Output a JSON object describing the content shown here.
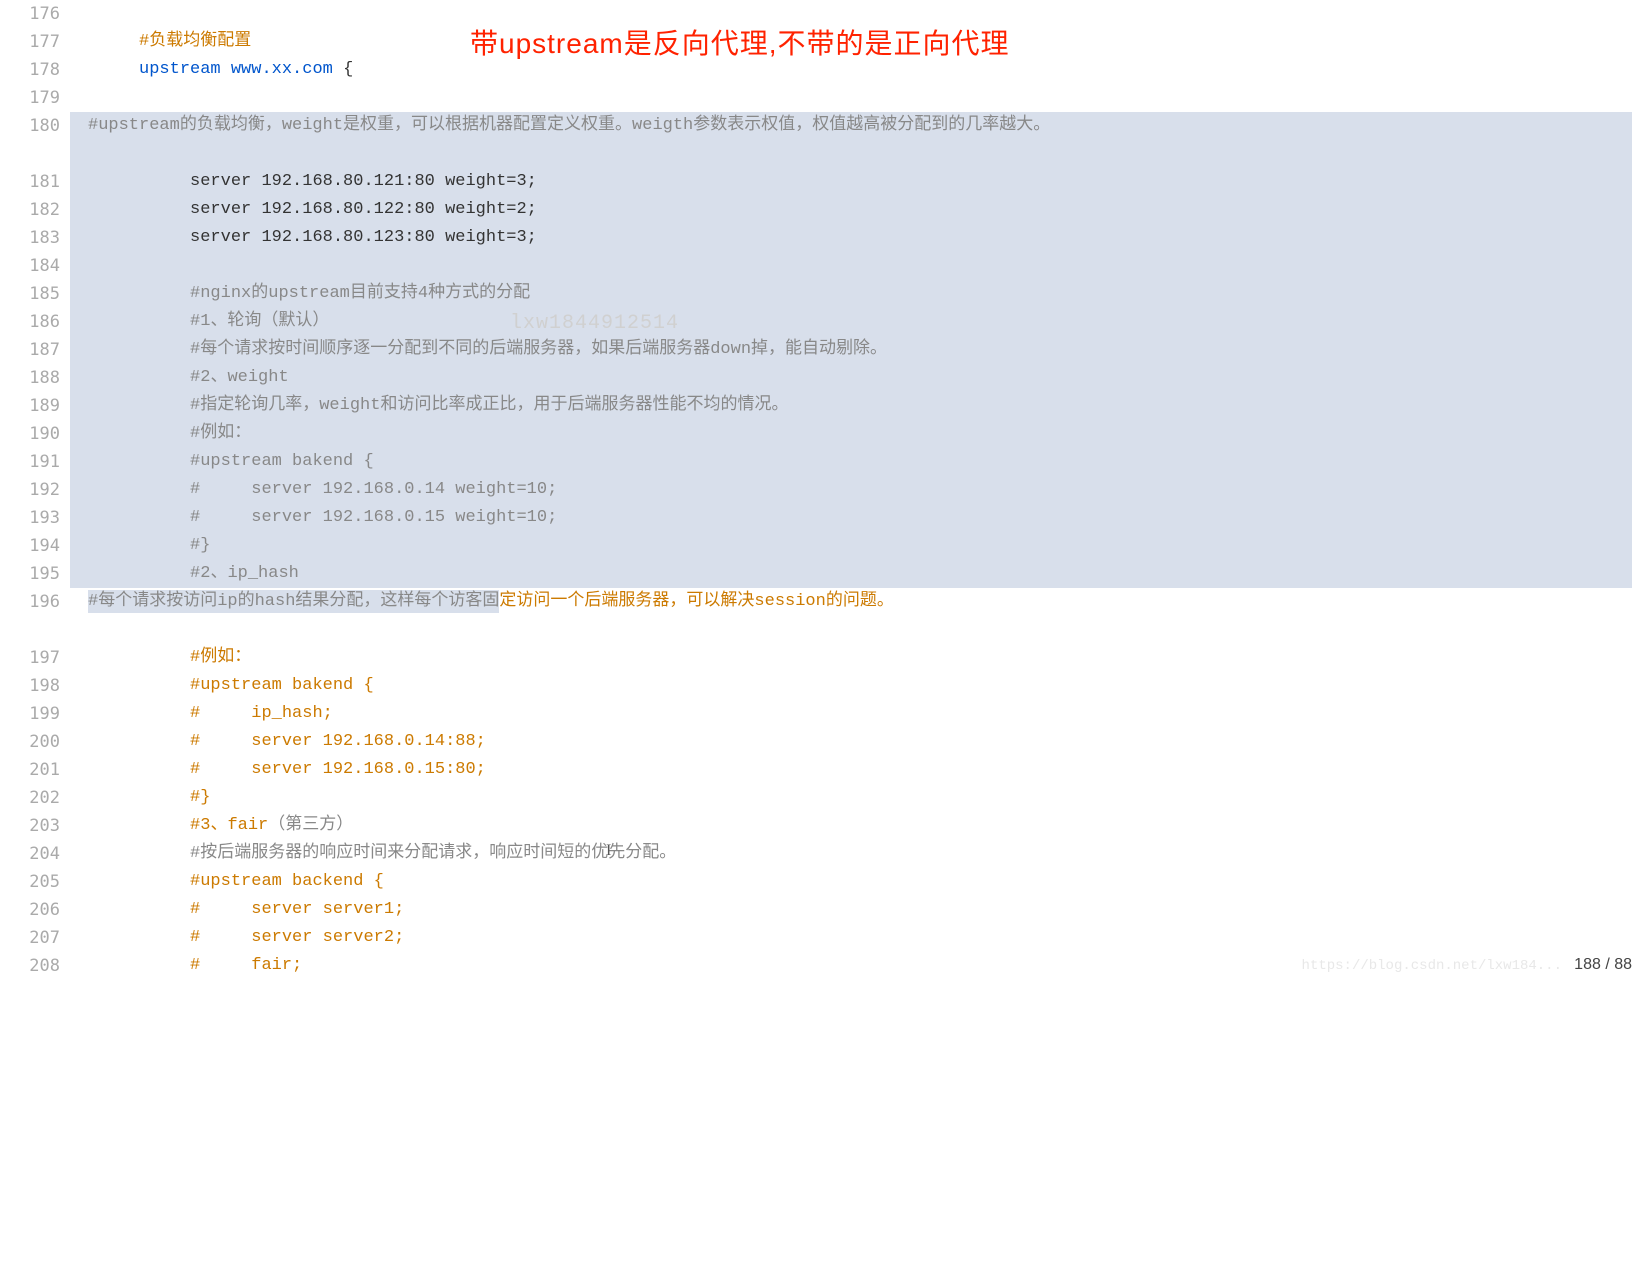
{
  "annotation": "带upstream是反向代理,不带的是正向代理",
  "watermark_center": "lxw1844912514",
  "watermark_bottom": "https://blog.csdn.net/lxw184...",
  "page_counter": "188 / 88",
  "lines": [
    {
      "num": "176",
      "indent": "",
      "highlight": false,
      "wrap": false,
      "segs": []
    },
    {
      "num": "177",
      "indent": "     ",
      "highlight": false,
      "wrap": false,
      "segs": [
        {
          "cls": "comment-orange",
          "t": "#负载均衡配置"
        }
      ]
    },
    {
      "num": "178",
      "indent": "     ",
      "highlight": false,
      "wrap": false,
      "segs": [
        {
          "cls": "kw",
          "t": "upstream"
        },
        {
          "cls": "txt",
          "t": " "
        },
        {
          "cls": "str",
          "t": "www.xx.com"
        },
        {
          "cls": "txt",
          "t": " {"
        }
      ]
    },
    {
      "num": "179",
      "indent": "",
      "highlight": false,
      "wrap": false,
      "segs": []
    },
    {
      "num": "180",
      "indent": "          ",
      "highlight": true,
      "wrap": true,
      "segs": [
        {
          "cls": "comment-gray",
          "t": "#upstream的负载均衡，"
        },
        {
          "cls": "comment-gray mono-bold-ish",
          "t": "weight"
        },
        {
          "cls": "comment-gray",
          "t": "是权重，可以根据机器配置定义权重。"
        },
        {
          "cls": "comment-gray mono-bold-ish",
          "t": "weigth"
        },
        {
          "cls": "comment-gray",
          "t": "参数表示权值，权值越高被分配到的几率越大。"
        }
      ]
    },
    {
      "num": "181",
      "indent": "          ",
      "highlight": true,
      "wrap": false,
      "segs": [
        {
          "cls": "txt",
          "t": "server 192.168.80.121:80 weight=3;"
        }
      ]
    },
    {
      "num": "182",
      "indent": "          ",
      "highlight": true,
      "wrap": false,
      "segs": [
        {
          "cls": "txt",
          "t": "server 192.168.80.122:80 weight=2;"
        }
      ]
    },
    {
      "num": "183",
      "indent": "          ",
      "highlight": true,
      "wrap": false,
      "segs": [
        {
          "cls": "txt",
          "t": "server 192.168.80.123:80 weight=3;"
        }
      ]
    },
    {
      "num": "184",
      "indent": "",
      "highlight": true,
      "wrap": false,
      "segs": []
    },
    {
      "num": "185",
      "indent": "          ",
      "highlight": true,
      "wrap": false,
      "segs": [
        {
          "cls": "comment-gray",
          "t": "#nginx的"
        },
        {
          "cls": "comment-gray mono-bold-ish",
          "t": "upstream"
        },
        {
          "cls": "comment-gray",
          "t": "目前支持"
        },
        {
          "cls": "comment-gray mono-bold-ish",
          "t": "4"
        },
        {
          "cls": "comment-gray",
          "t": "种方式的分配"
        }
      ]
    },
    {
      "num": "186",
      "indent": "          ",
      "highlight": true,
      "wrap": false,
      "segs": [
        {
          "cls": "comment-gray",
          "t": "#"
        },
        {
          "cls": "comment-gray mono-bold-ish",
          "t": "1"
        },
        {
          "cls": "comment-gray",
          "t": "、轮询（默认）"
        }
      ]
    },
    {
      "num": "187",
      "indent": "          ",
      "highlight": true,
      "wrap": false,
      "segs": [
        {
          "cls": "comment-gray",
          "t": "#每个请求按时间顺序逐一分配到不同的后端服务器，如果后端服务器"
        },
        {
          "cls": "comment-gray mono-bold-ish",
          "t": "down"
        },
        {
          "cls": "comment-gray",
          "t": "掉，能自动剔除。"
        }
      ]
    },
    {
      "num": "188",
      "indent": "          ",
      "highlight": true,
      "wrap": false,
      "segs": [
        {
          "cls": "comment-gray",
          "t": "#"
        },
        {
          "cls": "comment-gray mono-bold-ish",
          "t": "2"
        },
        {
          "cls": "comment-gray",
          "t": "、"
        },
        {
          "cls": "comment-gray mono-bold-ish",
          "t": "weight"
        }
      ]
    },
    {
      "num": "189",
      "indent": "          ",
      "highlight": true,
      "wrap": false,
      "segs": [
        {
          "cls": "comment-gray",
          "t": "#指定轮询几率，"
        },
        {
          "cls": "comment-gray mono-bold-ish",
          "t": "weight"
        },
        {
          "cls": "comment-gray",
          "t": "和访问比率成正比，用于后端服务器性能不均的情况。"
        }
      ]
    },
    {
      "num": "190",
      "indent": "          ",
      "highlight": true,
      "wrap": false,
      "segs": [
        {
          "cls": "comment-gray",
          "t": "#例如："
        }
      ]
    },
    {
      "num": "191",
      "indent": "          ",
      "highlight": true,
      "wrap": false,
      "segs": [
        {
          "cls": "comment-gray",
          "t": "#upstream bakend {"
        }
      ]
    },
    {
      "num": "192",
      "indent": "          ",
      "highlight": true,
      "wrap": false,
      "segs": [
        {
          "cls": "comment-gray",
          "t": "#     server 192.168.0.14 weight=10;"
        }
      ]
    },
    {
      "num": "193",
      "indent": "          ",
      "highlight": true,
      "wrap": false,
      "segs": [
        {
          "cls": "comment-gray",
          "t": "#     server 192.168.0.15 weight=10;"
        }
      ]
    },
    {
      "num": "194",
      "indent": "          ",
      "highlight": true,
      "wrap": false,
      "segs": [
        {
          "cls": "comment-gray",
          "t": "#}"
        }
      ]
    },
    {
      "num": "195",
      "indent": "          ",
      "highlight": true,
      "wrap": false,
      "segs": [
        {
          "cls": "comment-gray",
          "t": "#"
        },
        {
          "cls": "comment-gray mono-bold-ish",
          "t": "2"
        },
        {
          "cls": "comment-gray",
          "t": "、"
        },
        {
          "cls": "comment-gray mono-bold-ish",
          "t": "ip_hash"
        }
      ]
    },
    {
      "num": "196",
      "indent": "          ",
      "highlight": "partial",
      "wrap": true,
      "segs": [
        {
          "cls": "comment-gray",
          "t": "#每个请求按访问"
        },
        {
          "cls": "comment-gray mono-bold-ish",
          "t": "ip"
        },
        {
          "cls": "comment-gray",
          "t": "的"
        },
        {
          "cls": "comment-gray mono-bold-ish",
          "t": "hash"
        },
        {
          "cls": "comment-gray",
          "t": "结果分配，这样每个访客固"
        },
        {
          "cls": "comment-orange",
          "t": "定访问一个后端服务器，可以解决"
        },
        {
          "cls": "comment-orange mono-bold-ish",
          "t": "session"
        },
        {
          "cls": "comment-orange",
          "t": "的问题。"
        }
      ]
    },
    {
      "num": "197",
      "indent": "          ",
      "highlight": false,
      "wrap": false,
      "segs": [
        {
          "cls": "comment-orange",
          "t": "#例如："
        }
      ]
    },
    {
      "num": "198",
      "indent": "          ",
      "highlight": false,
      "wrap": false,
      "segs": [
        {
          "cls": "comment-orange",
          "t": "#upstream bakend {"
        }
      ]
    },
    {
      "num": "199",
      "indent": "          ",
      "highlight": false,
      "wrap": false,
      "segs": [
        {
          "cls": "comment-orange",
          "t": "#     ip_hash;"
        }
      ]
    },
    {
      "num": "200",
      "indent": "          ",
      "highlight": false,
      "wrap": false,
      "segs": [
        {
          "cls": "comment-orange",
          "t": "#     server 192.168.0.14:88;"
        }
      ]
    },
    {
      "num": "201",
      "indent": "          ",
      "highlight": false,
      "wrap": false,
      "segs": [
        {
          "cls": "comment-orange",
          "t": "#     server 192.168.0.15:80;"
        }
      ]
    },
    {
      "num": "202",
      "indent": "          ",
      "highlight": false,
      "wrap": false,
      "segs": [
        {
          "cls": "comment-orange",
          "t": "#}"
        }
      ]
    },
    {
      "num": "203",
      "indent": "          ",
      "highlight": false,
      "wrap": false,
      "segs": [
        {
          "cls": "comment-orange",
          "t": "#"
        },
        {
          "cls": "comment-orange mono-bold-ish",
          "t": "3"
        },
        {
          "cls": "comment-orange",
          "t": "、"
        },
        {
          "cls": "comment-orange mono-bold-ish",
          "t": "fair"
        },
        {
          "cls": "comment-gray",
          "t": "（第三方）"
        }
      ]
    },
    {
      "num": "204",
      "indent": "          ",
      "highlight": false,
      "wrap": false,
      "segs": [
        {
          "cls": "comment-gray",
          "t": "#按后端服务器的响应时间来分配请求，响应时间短的优先分配。"
        }
      ]
    },
    {
      "num": "205",
      "indent": "          ",
      "highlight": false,
      "wrap": false,
      "segs": [
        {
          "cls": "comment-orange",
          "t": "#upstream backend {"
        }
      ]
    },
    {
      "num": "206",
      "indent": "          ",
      "highlight": false,
      "wrap": false,
      "segs": [
        {
          "cls": "comment-orange",
          "t": "#     server server1;"
        }
      ]
    },
    {
      "num": "207",
      "indent": "          ",
      "highlight": false,
      "wrap": false,
      "segs": [
        {
          "cls": "comment-orange",
          "t": "#     server server2;"
        }
      ]
    },
    {
      "num": "208",
      "indent": "          ",
      "highlight": false,
      "wrap": false,
      "segs": [
        {
          "cls": "comment-orange",
          "t": "#     fair;"
        }
      ]
    }
  ]
}
